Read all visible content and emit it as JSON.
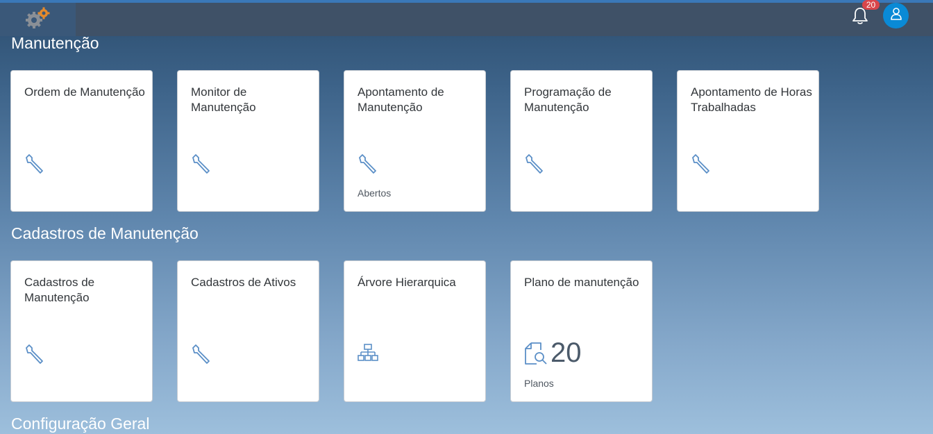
{
  "shell": {
    "notification_count": "20",
    "logo_icon": "gears-logo",
    "bell_icon": "bell-icon",
    "avatar_icon": "user-icon"
  },
  "sections": [
    {
      "title": "Manutenção",
      "tiles": [
        {
          "title": "Ordem de Manutenção",
          "icon": "wrench-icon",
          "footer": ""
        },
        {
          "title": "Monitor de Manutenção",
          "icon": "wrench-icon",
          "footer": ""
        },
        {
          "title": "Apontamento de Manutenção",
          "icon": "wrench-icon",
          "footer": "Abertos"
        },
        {
          "title": "Programação de Manutenção",
          "icon": "wrench-icon",
          "footer": ""
        },
        {
          "title": "Apontamento de Horas Trabalhadas",
          "icon": "wrench-icon",
          "footer": ""
        }
      ]
    },
    {
      "title": "Cadastros de Manutenção",
      "tiles": [
        {
          "title": "Cadastros de Manutenção",
          "icon": "wrench-icon",
          "footer": ""
        },
        {
          "title": "Cadastros de Ativos",
          "icon": "wrench-icon",
          "footer": ""
        },
        {
          "title": "Árvore Hierarquica",
          "icon": "hierarchy-icon",
          "footer": ""
        },
        {
          "title": "Plano de manutenção",
          "icon": "document-search-icon",
          "kpi": "20",
          "footer": "Planos"
        }
      ]
    },
    {
      "title": "Configuração Geral",
      "tiles": []
    }
  ],
  "colors": {
    "accent": "#0a8ad6",
    "badge": "#d9464b",
    "icon": "#5b8fc7"
  }
}
